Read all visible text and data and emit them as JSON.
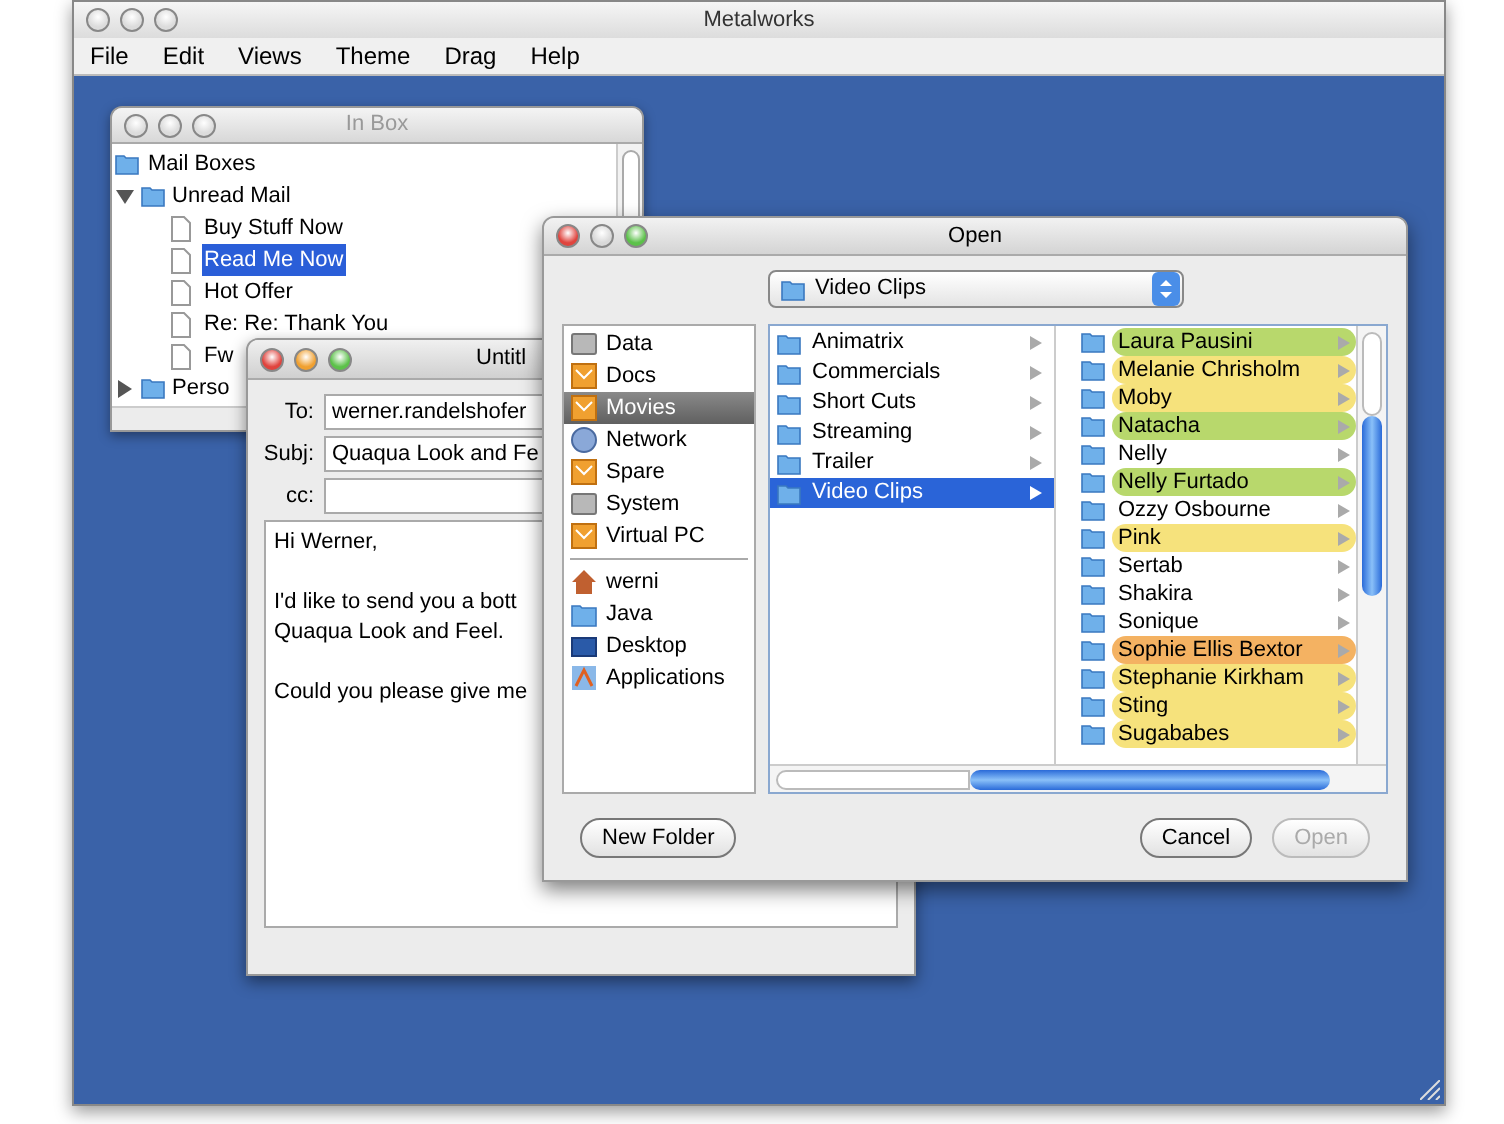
{
  "window": {
    "title": "Metalworks"
  },
  "menu": [
    "File",
    "Edit",
    "Views",
    "Theme",
    "Drag",
    "Help"
  ],
  "inbox": {
    "title": "In Box",
    "tree": [
      {
        "label": "Mail Boxes",
        "children": [
          {
            "label": "Unread Mail",
            "expanded": true,
            "children": [
              {
                "label": "Buy Stuff Now",
                "selected": false
              },
              {
                "label": "Read Me Now",
                "selected": true
              },
              {
                "label": "Hot Offer",
                "selected": false
              },
              {
                "label": "Re: Re: Thank You",
                "selected": false
              },
              {
                "label": "Fw",
                "selected": false
              }
            ]
          },
          {
            "label": "Perso",
            "expanded": false
          }
        ]
      }
    ]
  },
  "compose": {
    "title": "Untitl",
    "fields": [
      {
        "label": "To:",
        "value": "werner.randelshofer"
      },
      {
        "label": "Subj:",
        "value": "Quaqua Look and Fe"
      },
      {
        "label": "cc:"
      }
    ],
    "body": [
      [
        "Hi Werner,"
      ],
      [
        "I'd like to send you a bott",
        "Quaqua Look and Feel."
      ],
      [
        "Could you please give me"
      ]
    ]
  },
  "open_dialog": {
    "title": "Open",
    "location": "Video Clips",
    "sidebar": [
      [
        {
          "label": "Data",
          "kind": "disk",
          "selected": false
        },
        {
          "label": "Docs",
          "kind": "external",
          "selected": false
        },
        {
          "label": "Movies",
          "kind": "external",
          "selected": true
        },
        {
          "label": "Network",
          "kind": "network",
          "selected": false
        },
        {
          "label": "Spare",
          "kind": "external",
          "selected": false
        },
        {
          "label": "System",
          "kind": "disk",
          "selected": false
        },
        {
          "label": "Virtual PC",
          "kind": "external",
          "selected": false
        }
      ],
      [
        {
          "label": "werni",
          "kind": "home",
          "selected": false
        },
        {
          "label": "Java",
          "kind": "folder",
          "selected": false
        },
        {
          "label": "Desktop",
          "kind": "desktop",
          "selected": false
        },
        {
          "label": "Applications",
          "kind": "apps",
          "selected": false
        }
      ]
    ],
    "column_1": [
      {
        "label": "Animatrix",
        "selected": false
      },
      {
        "label": "Commercials",
        "selected": false
      },
      {
        "label": "Short Cuts",
        "selected": false
      },
      {
        "label": "Streaming",
        "selected": false
      },
      {
        "label": "Trailer",
        "selected": false
      },
      {
        "label": "Video Clips",
        "selected": true
      }
    ],
    "column_2": [
      {
        "label": "Laura Pausini",
        "color": "#b8d86c"
      },
      {
        "label": "Melanie Chrisholm",
        "color": "#f6e27c"
      },
      {
        "label": "Moby",
        "color": "#f6e27c"
      },
      {
        "label": "Natacha",
        "color": "#b8d86c"
      },
      {
        "label": "Nelly"
      },
      {
        "label": "Nelly Furtado",
        "color": "#b8d86c"
      },
      {
        "label": "Ozzy Osbourne"
      },
      {
        "label": "Pink",
        "color": "#f6e27c"
      },
      {
        "label": "Sertab"
      },
      {
        "label": "Shakira"
      },
      {
        "label": "Sonique"
      },
      {
        "label": "Sophie Ellis Bextor",
        "color": "#f4b262"
      },
      {
        "label": "Stephanie Kirkham",
        "color": "#f6e27c"
      },
      {
        "label": "Sting",
        "color": "#f6e27c"
      },
      {
        "label": "Sugababes",
        "color": "#f6e27c"
      }
    ],
    "buttons": [
      {
        "label": "New Folder",
        "disabled": false
      },
      {
        "label": "Cancel",
        "disabled": false
      },
      {
        "label": "Open",
        "disabled": true
      }
    ]
  }
}
